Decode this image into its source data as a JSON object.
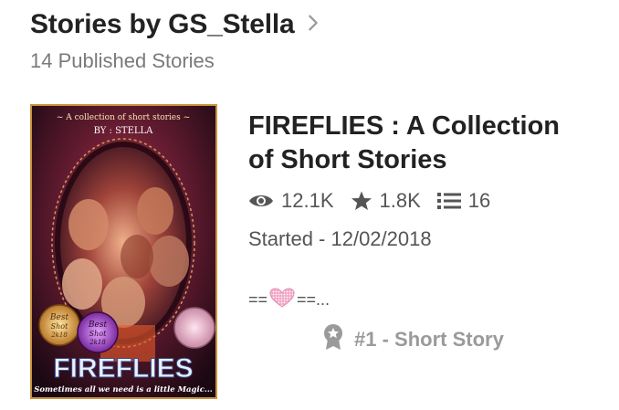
{
  "header": {
    "title": "Stories by GS_Stella",
    "subtitle": "14 Published Stories"
  },
  "story": {
    "title_line1": "FIREFLIES : A Collection",
    "title_line2": "of Short Stories",
    "reads": "12.1K",
    "votes": "1.8K",
    "parts": "16",
    "started": "Started - 12/02/2018",
    "desc_prefix": "==",
    "desc_suffix": "==...",
    "rank": "#1 - Short Story"
  },
  "cover": {
    "top_line": "~ A collection of short stories ~",
    "author": "BY : STELLA",
    "badge1_line1": "Best",
    "badge1_line2": "Shot",
    "badge1_line3": "2k18",
    "badge2_line1": "Best",
    "badge2_line2": "Shot",
    "badge2_line3": "2k18",
    "name": "FIREFLIES",
    "tagline": "Sometimes all we need is a little Magic..."
  },
  "icons": {
    "chevron": "chevron-right-icon",
    "reads": "eye-icon",
    "votes": "star-icon",
    "parts": "list-icon",
    "heart": "heart-icon",
    "rank": "ribbon-badge-icon"
  },
  "colors": {
    "title": "#222222",
    "subtitle": "#7a7a7a",
    "meta": "#555555",
    "rank": "#9a9a9a",
    "cover_border": "#c9933e"
  }
}
